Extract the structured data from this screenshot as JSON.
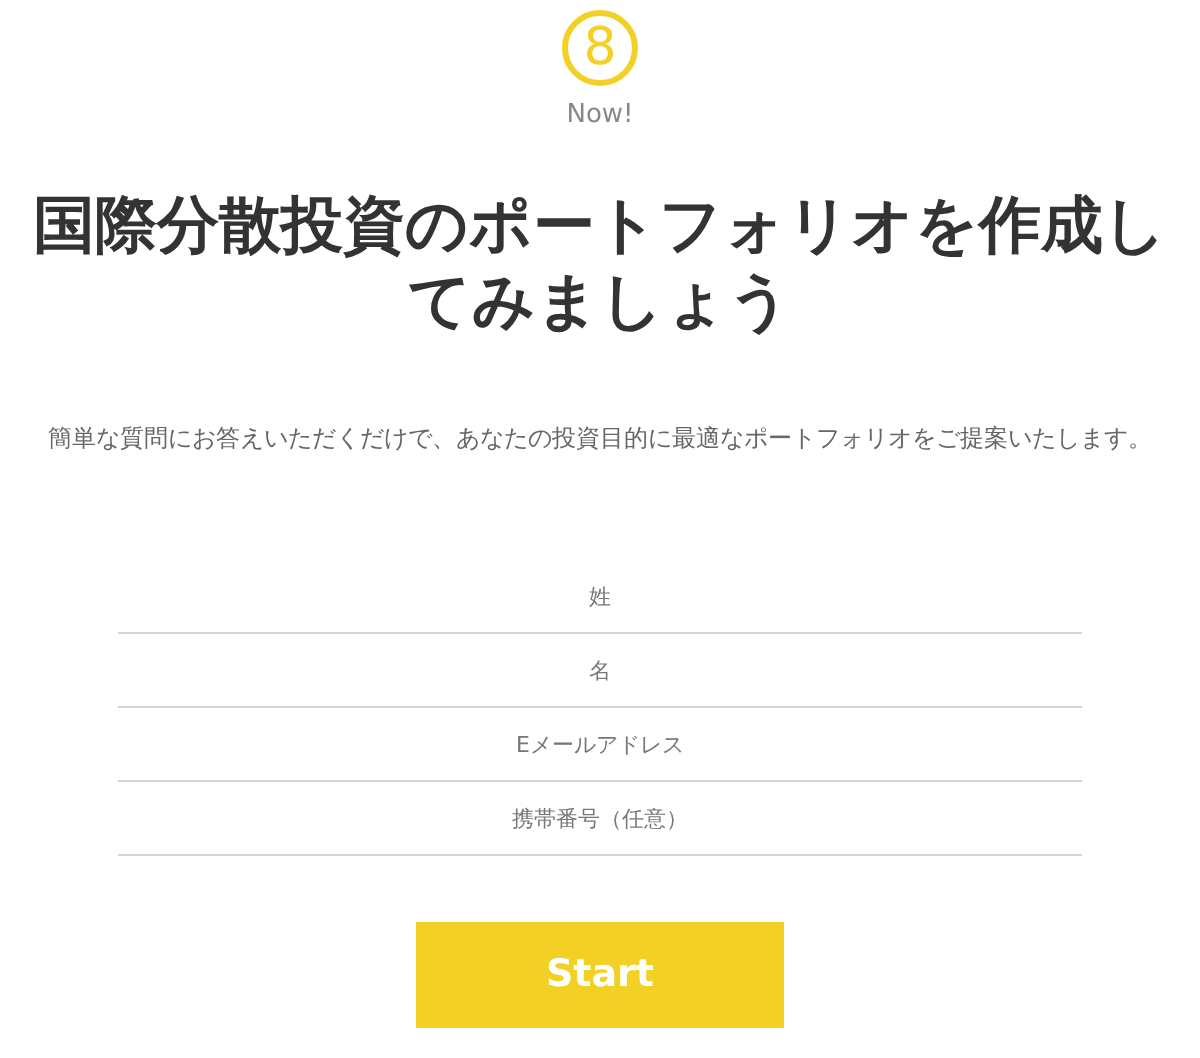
{
  "logo": {
    "mark": "8",
    "caption": "Now!"
  },
  "title": "国際分散投資のポートフォリオを作成してみましょう",
  "subtitle": "簡単な質問にお答えいただくだけで、あなたの投資目的に最適なポートフォリオをご提案いたします。",
  "fields": [
    {
      "placeholder": "姓"
    },
    {
      "placeholder": "名"
    },
    {
      "placeholder": "Eメールアドレス"
    },
    {
      "placeholder": "携帯番号（任意）"
    }
  ],
  "button": "Start"
}
